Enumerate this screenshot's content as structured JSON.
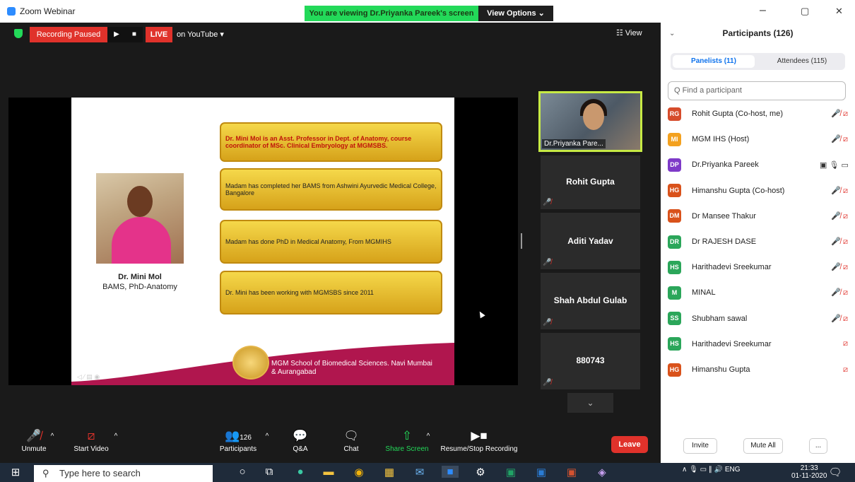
{
  "window": {
    "title": "Zoom Webinar",
    "minimize": "–",
    "maximize": "▢",
    "close": "✕"
  },
  "banner": {
    "viewing": "You are viewing Dr.Priyanka Pareek's screen",
    "view_options": "View Options ⌄"
  },
  "topbar": {
    "recording": "Recording Paused",
    "play": "▶",
    "stop": "■",
    "live": "LIVE",
    "youtube": "on YouTube ▾",
    "view": "☷ View"
  },
  "slide": {
    "name": "Dr. Mini Mol",
    "degree": "BAMS, PhD-Anatomy",
    "boxes": [
      "Dr. Mini Mol is an Asst. Professor in Dept. of Anatomy, course coordinator of MSc. Clinical Embryology at MGMSBS.",
      "Madam has completed her BAMS from Ashwini  Ayurvedic Medical College, Bangalore",
      "Madam has done PhD in Medical Anatomy, From MGMIHS",
      "Dr. Mini has been working with MGMSBS since 2011"
    ],
    "footer1": "MGM School of Biomedical Sciences. Navi Mumbai",
    "footer2": "& Aurangabad",
    "controls": "◁ ⁄ ▤ ◉"
  },
  "videos": {
    "active": "Dr.Priyanka Pare...",
    "tiles": [
      "Rohit Gupta",
      "Aditi Yadav",
      "Shah Abdul Gulab",
      "880743"
    ],
    "muted": "🎤̸",
    "scroll": "⌄"
  },
  "toolbar": {
    "unmute": "Unmute",
    "start_video": "Start Video",
    "participants": "Participants",
    "count": "126",
    "qa": "Q&A",
    "chat": "Chat",
    "share": "Share Screen",
    "record": "Resume/Stop Recording",
    "leave": "Leave",
    "caret": "^"
  },
  "panel": {
    "title": "Participants (126)",
    "chevron": "⌄",
    "panelists": "Panelists (11)",
    "attendees": "Attendees (115)",
    "search": "Q  Find a participant",
    "people": [
      {
        "initials": "RG",
        "name": "Rohit Gupta (Co-host, me)",
        "color": "#d64c2b",
        "icons": "🎤̸ ⧄"
      },
      {
        "initials": "MI",
        "name": "MGM IHS (Host)",
        "color": "#f3a11f",
        "icons": "🎤̸ ⧄"
      },
      {
        "initials": "DP",
        "name": "Dr.Priyanka Pareek",
        "color": "#7e3ac8",
        "icons": "▣ 🎙 ▭"
      },
      {
        "initials": "HG",
        "name": "Himanshu Gupta (Co-host)",
        "color": "#d9521b",
        "icons": "🎤̸ ⧄"
      },
      {
        "initials": "DM",
        "name": "Dr Mansee Thakur",
        "color": "#d9521b",
        "icons": "🎤̸ ⧄"
      },
      {
        "initials": "DR",
        "name": "Dr RAJESH DASE",
        "color": "#2ba65a",
        "icons": "🎤̸ ⧄"
      },
      {
        "initials": "HS",
        "name": "Harithadevi Sreekumar",
        "color": "#2ba65a",
        "icons": "🎤̸ ⧄"
      },
      {
        "initials": "M",
        "name": "MINAL",
        "color": "#2ba65a",
        "icons": "🎤̸ ⧄"
      },
      {
        "initials": "SS",
        "name": "Shubham sawal",
        "color": "#2ba65a",
        "icons": "🎤̸ ⧄"
      },
      {
        "initials": "HS",
        "name": "Harithadevi Sreekumar",
        "color": "#2ba65a",
        "icons": "⧄"
      },
      {
        "initials": "HG",
        "name": "Himanshu Gupta",
        "color": "#d9521b",
        "icons": "⧄"
      }
    ],
    "invite": "Invite",
    "mute_all": "Mute All",
    "more": "..."
  },
  "taskbar": {
    "search": "Type here to search",
    "lang": "ENG",
    "time": "21:33",
    "date": "01-11-2020"
  },
  "colors": {
    "accent": "#0e72ed",
    "red": "#e0322b",
    "green": "#23d959"
  }
}
